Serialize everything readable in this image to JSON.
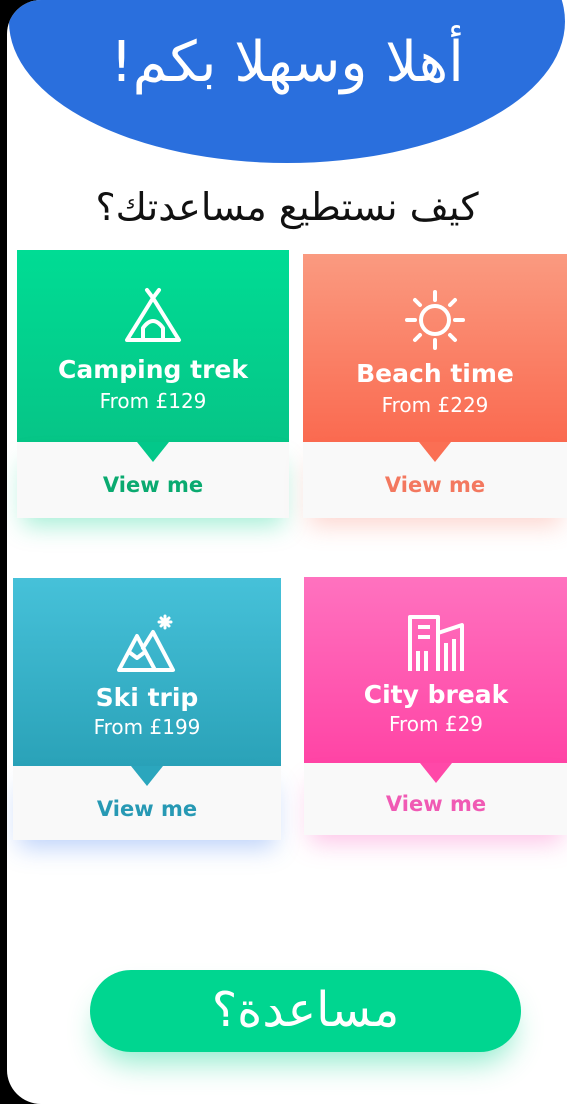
{
  "header": {
    "welcome": "أهلا وسهلا بكم!"
  },
  "question": "كيف نستطيع مساعدتك؟",
  "cards": [
    {
      "title": "Camping trek",
      "price": "From £129",
      "cta": "View me",
      "icon": "tent-icon"
    },
    {
      "title": "Beach time",
      "price": "From £229",
      "cta": "View me",
      "icon": "sun-icon"
    },
    {
      "title": "Ski trip",
      "price": "From £199",
      "cta": "View me",
      "icon": "mountain-icon"
    },
    {
      "title": "City break",
      "price": "From £29",
      "cta": "View me",
      "icon": "city-icon"
    }
  ],
  "help_button": "مساعدة؟",
  "colors": {
    "header_blue": "#2a6fdd",
    "camping_green": "#00dc94",
    "beach_coral": "#fa6a50",
    "ski_teal": "#2aa2b8",
    "city_pink": "#ff44a5",
    "help_green": "#00d690"
  }
}
